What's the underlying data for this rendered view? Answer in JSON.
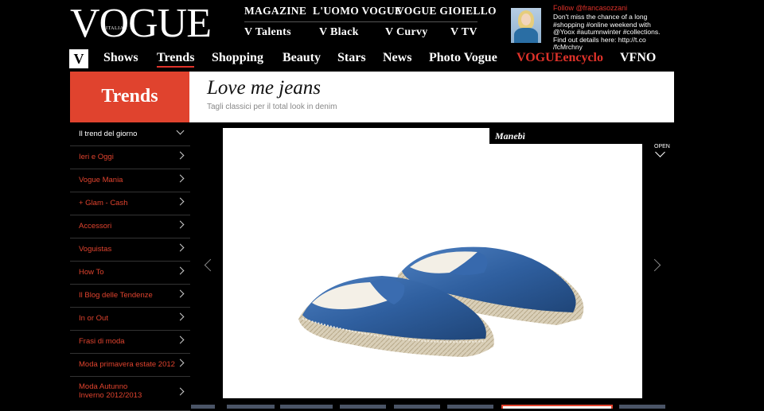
{
  "logo": {
    "text": "VOGUE",
    "sub": "ITALIA"
  },
  "top_nav": {
    "row1": [
      "MAGAZINE",
      "L'UOMO VOGUE",
      "VOGUE GIOIELLO"
    ],
    "row2": [
      "V Talents",
      "V Black",
      "V Curvy",
      "V TV"
    ]
  },
  "twitter": {
    "follow": "Follow @francasozzani",
    "text": "Don't miss the chance of a long #shopping #online weekend with @Yoox #autumnwinter #collections. Find out details here: http://t.co /fcMrchny"
  },
  "main_nav": {
    "home": "V",
    "items": [
      "Shows",
      "Trends",
      "Shopping",
      "Beauty",
      "Stars",
      "News",
      "Photo Vogue",
      "VOGUEencyclo",
      "VFNO"
    ],
    "active": "Trends",
    "accent": "#e0322a"
  },
  "section": {
    "label": "Trends",
    "color": "#e0432e"
  },
  "article": {
    "title": "Love me jeans",
    "subtitle": "Tagli classici per il total look in denim"
  },
  "sidebar": {
    "items": [
      "Il trend del giorno",
      "Ieri e Oggi",
      "Vogue Mania",
      "+ Glam - Cash",
      "Accessori",
      "Voguistas",
      "How To",
      "Il Blog delle Tendenze",
      "In or Out",
      "Frasi di moda",
      "Moda primavera estate 2012",
      "Moda Autunno",
      "Inverno 2012/2013"
    ]
  },
  "gallery": {
    "caption": "Manebì",
    "open_label": "OPEN",
    "image_alt": "denim-espadrilles",
    "arrow_prev": "chevron-left-icon",
    "arrow_next": "chevron-right-icon"
  }
}
